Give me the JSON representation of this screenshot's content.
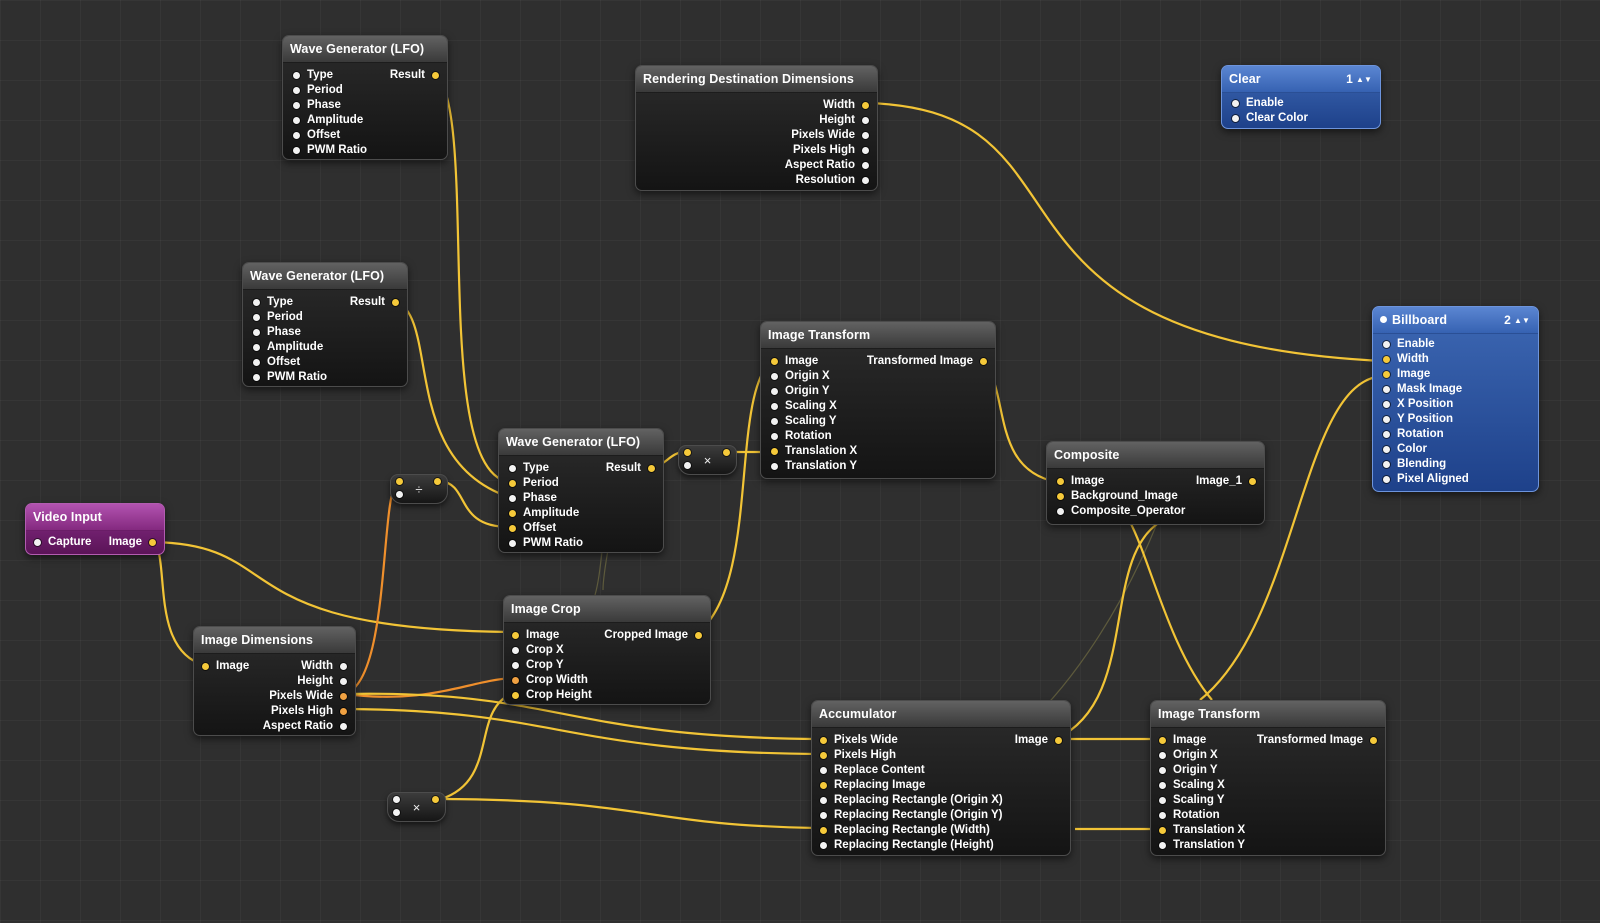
{
  "nodes": {
    "lfo_top": {
      "title": "Wave Generator (LFO)",
      "inputs": [
        "Type",
        "Period",
        "Phase",
        "Amplitude",
        "Offset",
        "PWM Ratio"
      ],
      "outputs": [
        "Result"
      ]
    },
    "lfo_mid": {
      "title": "Wave Generator (LFO)",
      "inputs": [
        "Type",
        "Period",
        "Phase",
        "Amplitude",
        "Offset",
        "PWM Ratio"
      ],
      "outputs": [
        "Result"
      ]
    },
    "lfo_center": {
      "title": "Wave Generator (LFO)",
      "inputs": [
        "Type",
        "Period",
        "Phase",
        "Amplitude",
        "Offset",
        "PWM Ratio"
      ],
      "outputs": [
        "Result"
      ]
    },
    "render_dims": {
      "title": "Rendering Destination Dimensions",
      "inputs": [],
      "outputs": [
        "Width",
        "Height",
        "Pixels Wide",
        "Pixels High",
        "Aspect Ratio",
        "Resolution"
      ]
    },
    "clear": {
      "title": "Clear",
      "badge": "1",
      "inputs": [
        "Enable",
        "Clear Color"
      ],
      "outputs": []
    },
    "billboard": {
      "title": "Billboard",
      "badge": "2",
      "inputs": [
        "Enable",
        "Width",
        "Image",
        "Mask Image",
        "X Position",
        "Y Position",
        "Rotation",
        "Color",
        "Blending",
        "Pixel Aligned"
      ],
      "outputs": []
    },
    "transform_top": {
      "title": "Image Transform",
      "inputs": [
        "Image",
        "Origin X",
        "Origin Y",
        "Scaling X",
        "Scaling Y",
        "Rotation",
        "Translation X",
        "Translation Y"
      ],
      "outputs": [
        "Transformed Image"
      ]
    },
    "composite": {
      "title": "Composite",
      "inputs": [
        "Image",
        "Background_Image",
        "Composite_Operator"
      ],
      "outputs": [
        "Image_1"
      ]
    },
    "video_input": {
      "title": "Video Input",
      "inputs": [
        "Capture"
      ],
      "outputs": [
        "Image"
      ]
    },
    "image_dims": {
      "title": "Image Dimensions",
      "inputs": [
        "Image"
      ],
      "outputs": [
        "Width",
        "Height",
        "Pixels Wide",
        "Pixels High",
        "Aspect Ratio"
      ]
    },
    "image_crop": {
      "title": "Image Crop",
      "inputs": [
        "Image",
        "Crop X",
        "Crop Y",
        "Crop Width",
        "Crop Height"
      ],
      "outputs": [
        "Cropped Image"
      ]
    },
    "accumulator": {
      "title": "Accumulator",
      "inputs": [
        "Pixels Wide",
        "Pixels High",
        "Replace Content",
        "Replacing Image",
        "Replacing Rectangle (Origin X)",
        "Replacing Rectangle (Origin Y)",
        "Replacing Rectangle (Width)",
        "Replacing Rectangle (Height)"
      ],
      "outputs": [
        "Image"
      ]
    },
    "transform_bottom": {
      "title": "Image Transform",
      "inputs": [
        "Image",
        "Origin X",
        "Origin Y",
        "Scaling X",
        "Scaling Y",
        "Rotation",
        "Translation X",
        "Translation Y"
      ],
      "outputs": [
        "Transformed Image"
      ]
    }
  },
  "operators": {
    "divide": "÷",
    "multiply_top": "×",
    "multiply_bottom": "×"
  },
  "colors": {
    "canvas": "#2f2f2f",
    "wire": "#f2c436",
    "wire_alt": "#ef8f2c",
    "node_dark": "#1c1c1c",
    "node_blue": "#3662b2",
    "node_purple": "#84297f"
  }
}
